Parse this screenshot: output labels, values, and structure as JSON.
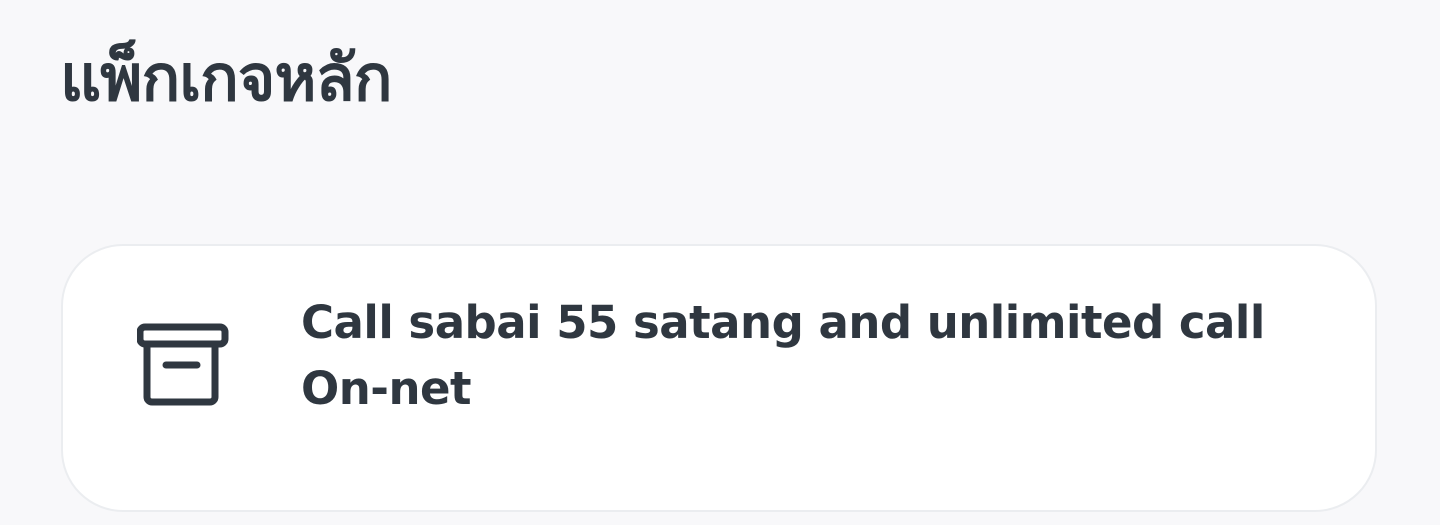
{
  "section": {
    "title": "แพ็กเกจหลัก"
  },
  "package": {
    "icon": "archive-box-icon",
    "name_line1": "Call sabai 55 satang and unlimited call",
    "name_line2": "On-net"
  },
  "colors": {
    "background": "#f8f8fa",
    "card": "#ffffff",
    "text": "#2f3740",
    "card_border": "#ebedf0"
  }
}
